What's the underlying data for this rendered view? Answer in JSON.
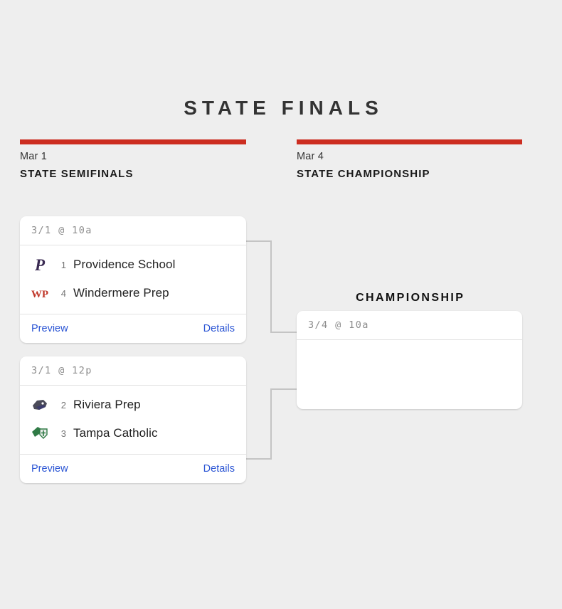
{
  "page": {
    "title": "STATE FINALS"
  },
  "rounds": [
    {
      "id": "semifinals",
      "date": "Mar 1",
      "name": "STATE SEMIFINALS",
      "accent_color": "#cc2d20"
    },
    {
      "id": "championship",
      "date": "Mar 4",
      "name": "STATE CHAMPIONSHIP",
      "accent_color": "#cc2d20"
    }
  ],
  "championship_label": "CHAMPIONSHIP",
  "links": {
    "preview_label": "Preview",
    "details_label": "Details",
    "link_color": "#2b55d4"
  },
  "games": [
    {
      "id": "semifinal-1",
      "datetime": "3/1 @ 10a",
      "teams": [
        {
          "seed": "1",
          "name": "Providence School",
          "logo_icon": "providence-school-logo",
          "logo_color": "#3a2a52"
        },
        {
          "seed": "4",
          "name": "Windermere Prep",
          "logo_icon": "windermere-prep-logo",
          "logo_color": "#c0392b"
        }
      ]
    },
    {
      "id": "semifinal-2",
      "datetime": "3/1 @ 12p",
      "teams": [
        {
          "seed": "2",
          "name": "Riviera Prep",
          "logo_icon": "riviera-prep-logo",
          "logo_color": "#4a4a58"
        },
        {
          "seed": "3",
          "name": "Tampa Catholic",
          "logo_icon": "tampa-catholic-logo",
          "logo_color": "#2f7a45"
        }
      ]
    },
    {
      "id": "final",
      "datetime": "3/4 @ 10a",
      "teams": []
    }
  ]
}
